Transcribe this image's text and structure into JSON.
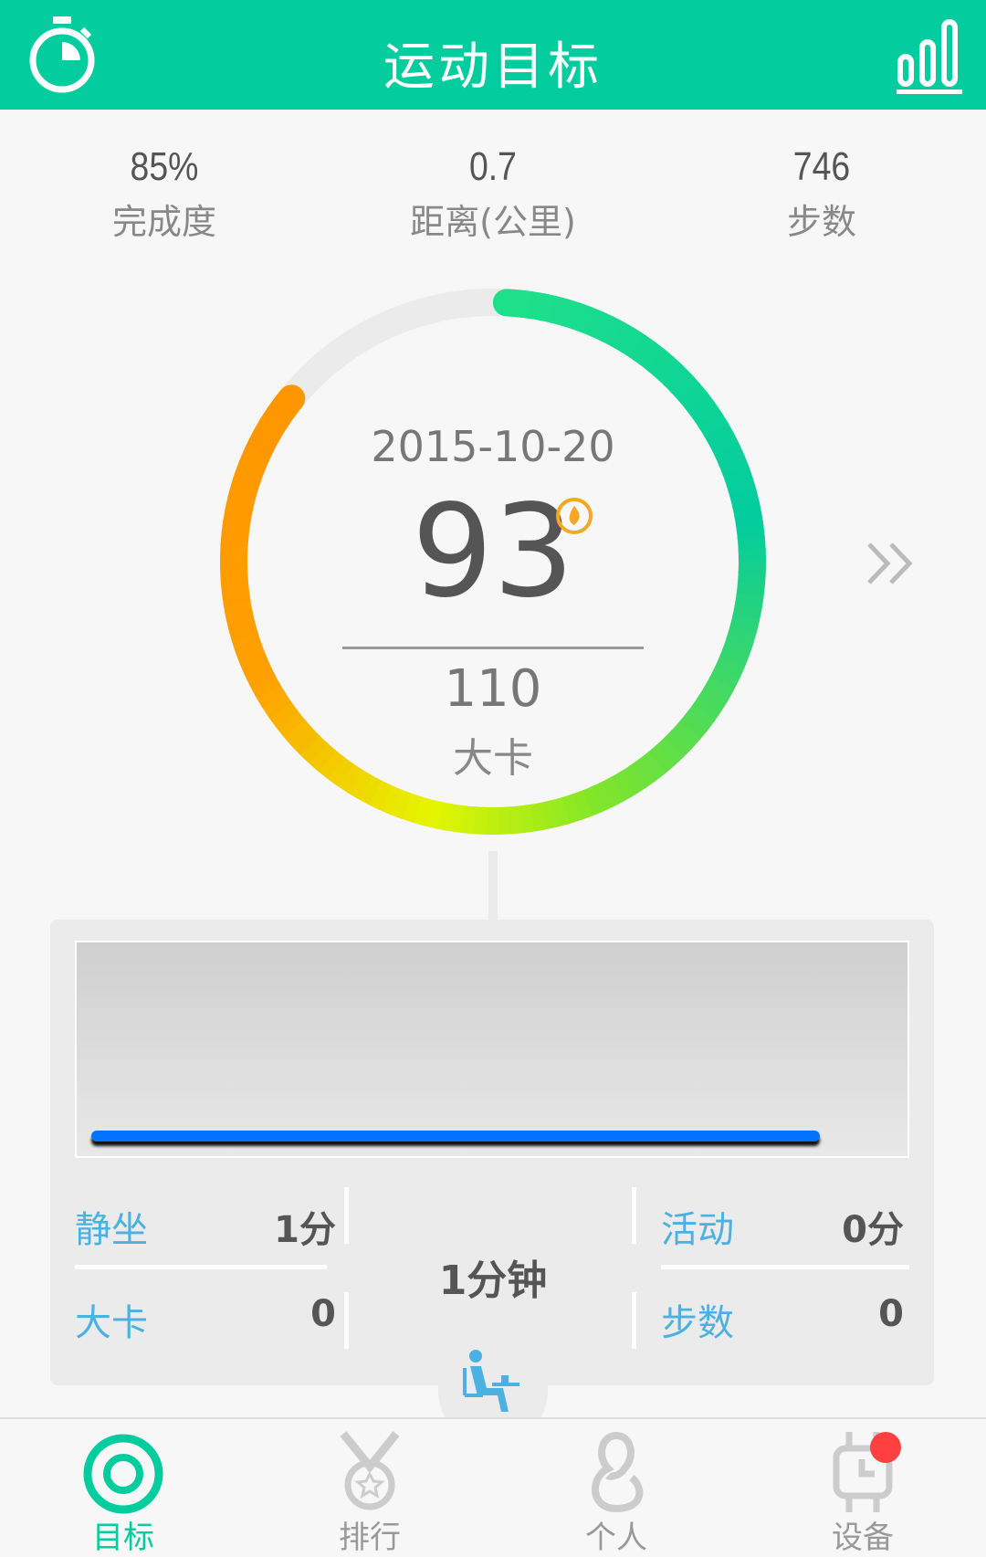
{
  "header": {
    "title": "运动目标",
    "left_icon": "stopwatch-icon",
    "right_icon": "bar-chart-icon"
  },
  "stats": [
    {
      "value": "85%",
      "label": "完成度"
    },
    {
      "value": "0.7",
      "label": "距离(公里)"
    },
    {
      "value": "746",
      "label": "步数"
    }
  ],
  "ring": {
    "date": "2015-10-20",
    "score": "93",
    "score_icon": "flame-icon",
    "calories": "110",
    "calories_unit": "大卡",
    "progress_percent": 85,
    "colors": [
      "#1fe08a",
      "#03cc9e",
      "#e6f500",
      "#ff9900"
    ]
  },
  "detail": {
    "sit_label": "静坐",
    "sit_value": "1分",
    "cal_label": "大卡",
    "cal_value": "0",
    "active_label": "活动",
    "active_value": "0分",
    "steps_label": "步数",
    "steps_value": "0",
    "total": "1分钟",
    "bar_color": "#0373ff"
  },
  "nav": [
    {
      "label": "目标",
      "icon": "target-icon",
      "active": true
    },
    {
      "label": "排行",
      "icon": "medal-icon"
    },
    {
      "label": "个人",
      "icon": "person-icon"
    },
    {
      "label": "设备",
      "icon": "watch-icon",
      "badge": true
    }
  ],
  "accent": "#03cc9e"
}
